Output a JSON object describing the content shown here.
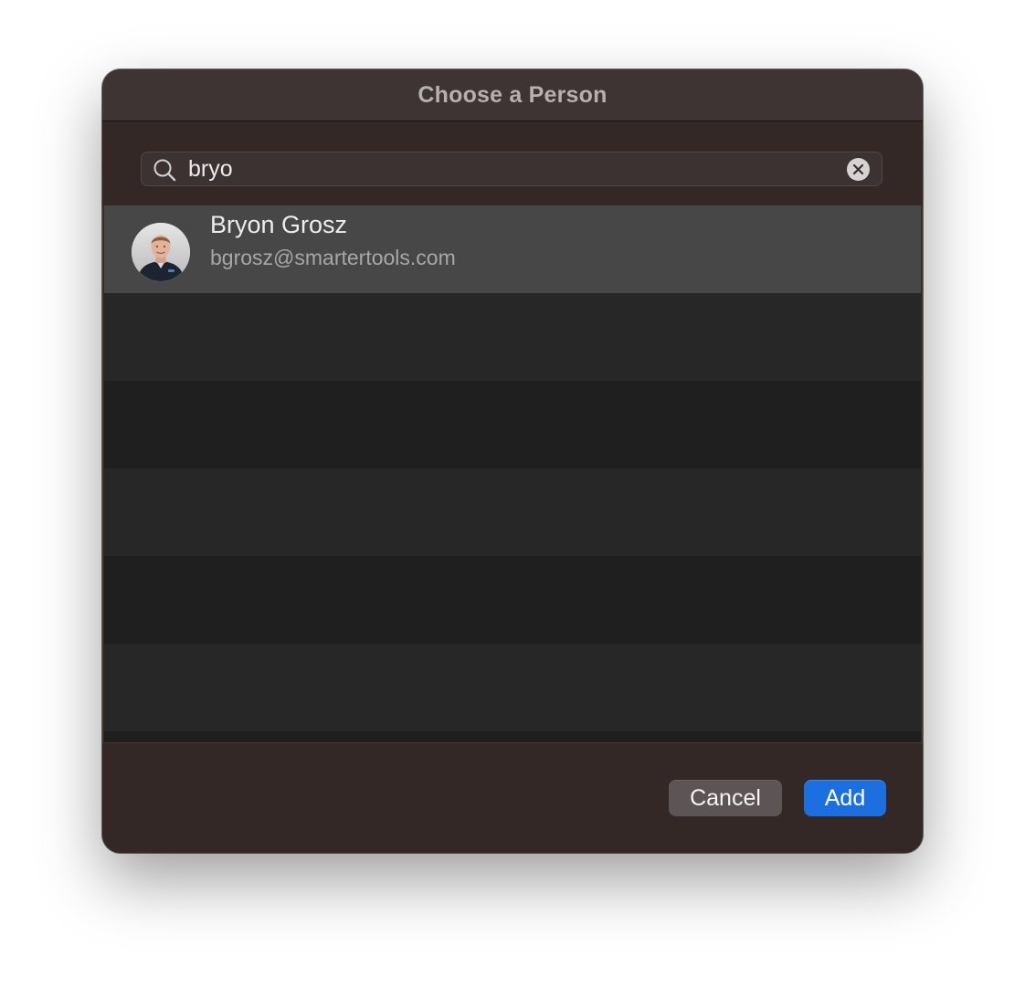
{
  "dialog": {
    "title": "Choose a Person"
  },
  "search": {
    "value": "bryo",
    "icon": "magnifier-icon",
    "clear_icon": "clear-icon"
  },
  "results": [
    {
      "name": "Bryon Grosz",
      "email": "bgrosz@smartertools.com",
      "avatar": "contact-photo",
      "selected": true
    }
  ],
  "buttons": {
    "cancel_label": "Cancel",
    "add_label": "Add"
  },
  "colors": {
    "accent": "#1c6fe0",
    "background": "#342827",
    "selected_row": "#474747"
  }
}
